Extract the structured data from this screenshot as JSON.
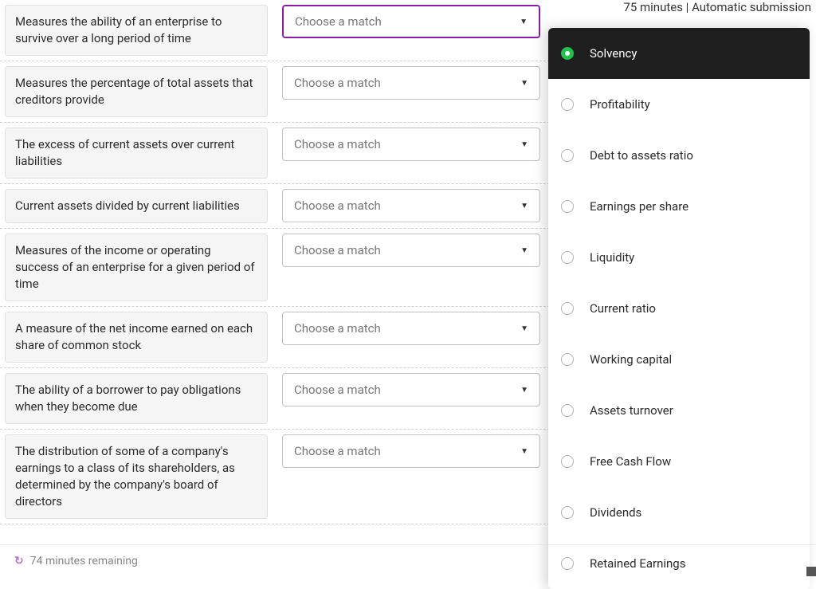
{
  "header": {
    "time_limit": "75 minutes | Automatic submission"
  },
  "dropdown_placeholder": "Choose a match",
  "questions": [
    {
      "text": "Measures the ability of an enterprise to survive over a long period of time",
      "active": true
    },
    {
      "text": "Measures the percentage of total assets that creditors provide",
      "active": false
    },
    {
      "text": "The excess of current assets over current liabilities",
      "active": false
    },
    {
      "text": "Current assets divided by current liabilities",
      "active": false
    },
    {
      "text": "Measures of the income or operating success of an enterprise for a given period of time",
      "active": false
    },
    {
      "text": "A measure of the net income earned on each share of common stock",
      "active": false
    },
    {
      "text": "The ability of a borrower to pay obligations when they become due",
      "active": false
    },
    {
      "text": "The distribution of some of a company's earnings to a class of its shareholders, as determined by the company's board of directors",
      "active": false
    }
  ],
  "options": [
    {
      "label": "Solvency",
      "selected": true
    },
    {
      "label": "Profitability",
      "selected": false
    },
    {
      "label": "Debt to assets ratio",
      "selected": false
    },
    {
      "label": "Earnings per share",
      "selected": false
    },
    {
      "label": "Liquidity",
      "selected": false
    },
    {
      "label": "Current ratio",
      "selected": false
    },
    {
      "label": "Working capital",
      "selected": false
    },
    {
      "label": "Assets turnover",
      "selected": false
    },
    {
      "label": "Free Cash Flow",
      "selected": false
    },
    {
      "label": "Dividends",
      "selected": false
    },
    {
      "label": "Retained Earnings",
      "selected": false
    }
  ],
  "footer": {
    "remaining": "74 minutes remaining"
  }
}
